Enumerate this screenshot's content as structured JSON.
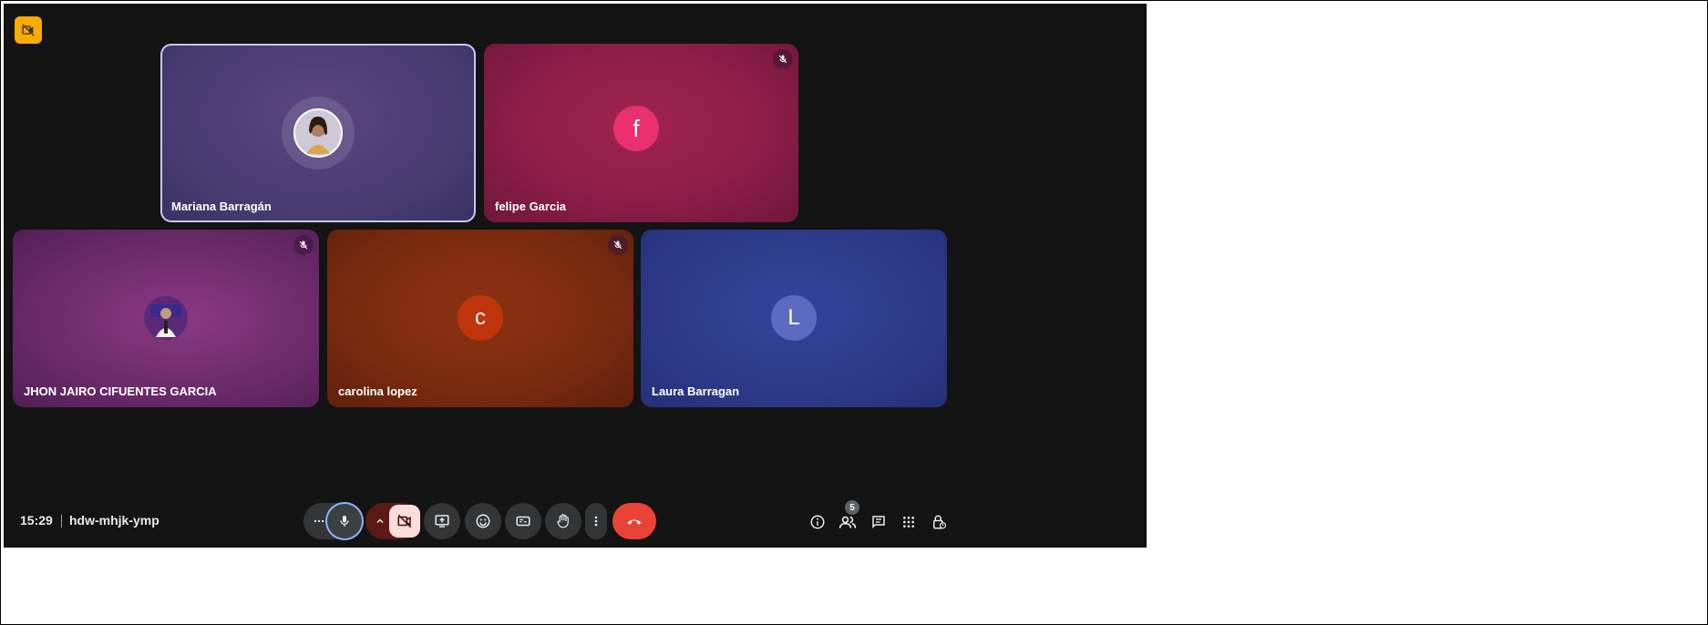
{
  "status": {
    "camera_off_badge_icon": "camera-off-icon"
  },
  "participants": [
    {
      "name": "Mariana Barragán",
      "avatar": "photo",
      "muted": false,
      "active": true,
      "color": "#4e3f78"
    },
    {
      "name": "felipe Garcia",
      "avatar_letter": "f",
      "muted": true,
      "color": "#8a1d47",
      "avatar_color": "#e8316e"
    },
    {
      "name": "JHON JAIRO CIFUENTES GARCIA",
      "avatar": "photo",
      "muted": true,
      "color": "#6b2a6a"
    },
    {
      "name": "carolina lopez",
      "avatar_letter": "c",
      "muted": true,
      "color": "#7a2a10",
      "avatar_color": "#bf360c"
    },
    {
      "name": "Laura Barragan",
      "avatar_letter": "L",
      "muted": false,
      "color": "#2d3a8a",
      "avatar_color": "#5c6bc0"
    }
  ],
  "bottom_bar": {
    "time": "15:29",
    "meeting_code": "hdw-mhjk-ymp",
    "people_count": "5"
  },
  "controls": {
    "more_audio_icon": "more-horizontal-icon",
    "mic_icon": "microphone-icon",
    "camera_options_icon": "chevron-up-icon",
    "camera_icon": "camera-off-icon",
    "present_icon": "present-screen-icon",
    "reactions_icon": "emoji-icon",
    "captions_icon": "captions-icon",
    "raise_hand_icon": "raise-hand-icon",
    "more_options_icon": "more-vertical-icon",
    "leave_icon": "hang-up-icon"
  },
  "colors": {
    "background": "#141414",
    "leave_red": "#ea4335",
    "camera_off_pink": "#f9dedc",
    "mic_ring": "#8ab4f8",
    "badge_yellow": "#f9ab00"
  }
}
